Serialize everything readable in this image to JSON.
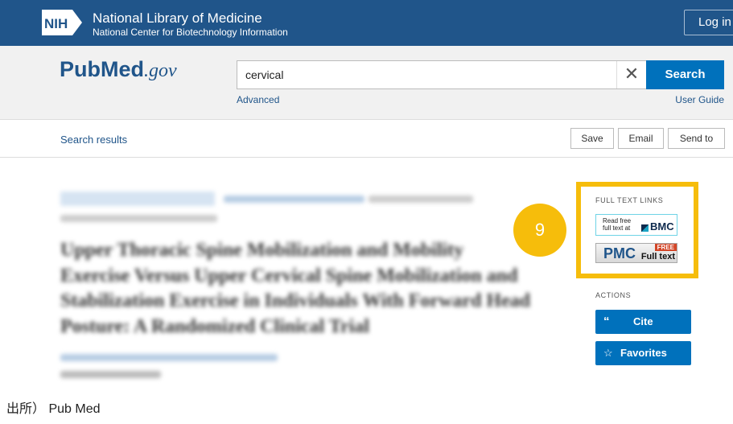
{
  "header": {
    "org_logo": "NIH",
    "title": "National Library of Medicine",
    "subtitle": "National Center for Biotechnology Information",
    "login": "Log in"
  },
  "search": {
    "logo_pub": "Pub",
    "logo_med": "Med",
    "logo_gov": ".gov",
    "value": "cervical",
    "button": "Search",
    "advanced": "Advanced",
    "user_guide": "User Guide",
    "clear_icon": "close-icon"
  },
  "nav": {
    "back_link": "Search results",
    "buttons": [
      "Save",
      "Email",
      "Send to"
    ]
  },
  "article": {
    "title": "Upper Thoracic Spine Mobilization and Mobility Exercise Versus Upper Cervical Spine Mobilization and Stabilization Exercise in Individuals With Forward Head Posture: A Randomized Clinical Trial"
  },
  "sidebar": {
    "full_text_label": "FULL TEXT LINKS",
    "bmc_line1": "Read free",
    "bmc_line2": "full text at",
    "bmc_brand": "BMC",
    "pmc_brand": "PMC",
    "pmc_free": "FREE",
    "pmc_full": "Full text",
    "actions_label": "ACTIONS",
    "cite": "Cite",
    "favorites": "Favorites",
    "highlight_color": "#f6bd0b"
  },
  "annotation": {
    "number": "9"
  },
  "footer": {
    "source": "出所） Pub Med"
  }
}
